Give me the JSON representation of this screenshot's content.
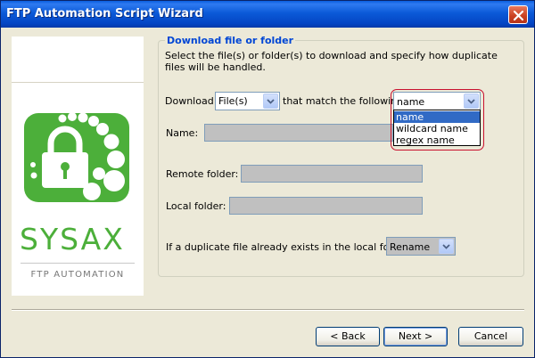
{
  "window": {
    "title": "FTP Automation Script Wizard"
  },
  "branding": {
    "name": "SYSAX",
    "subtitle": "FTP AUTOMATION",
    "brand_color": "#4caf3a"
  },
  "section": {
    "title": "Download file or folder",
    "description": "Select the file(s) or folder(s) to download and specify how duplicate files will be handled."
  },
  "download_row": {
    "label": "Download",
    "type_value": "File(s)",
    "match_label": "that match the following",
    "match_value": "name",
    "match_options": [
      "name",
      "wildcard name",
      "regex name"
    ]
  },
  "fields": {
    "name_label": "Name:",
    "remote_label": "Remote folder:",
    "local_label": "Local folder:"
  },
  "duplicate": {
    "label": "If a duplicate file already exists in the local folder,",
    "value": "Rename"
  },
  "buttons": {
    "back": "< Back",
    "next": "Next >",
    "cancel": "Cancel"
  },
  "colors": {
    "titlebar": "#0a5fe0",
    "section_title": "#0046d5",
    "selection": "#316ac5",
    "highlight_ring": "#c8102e"
  }
}
